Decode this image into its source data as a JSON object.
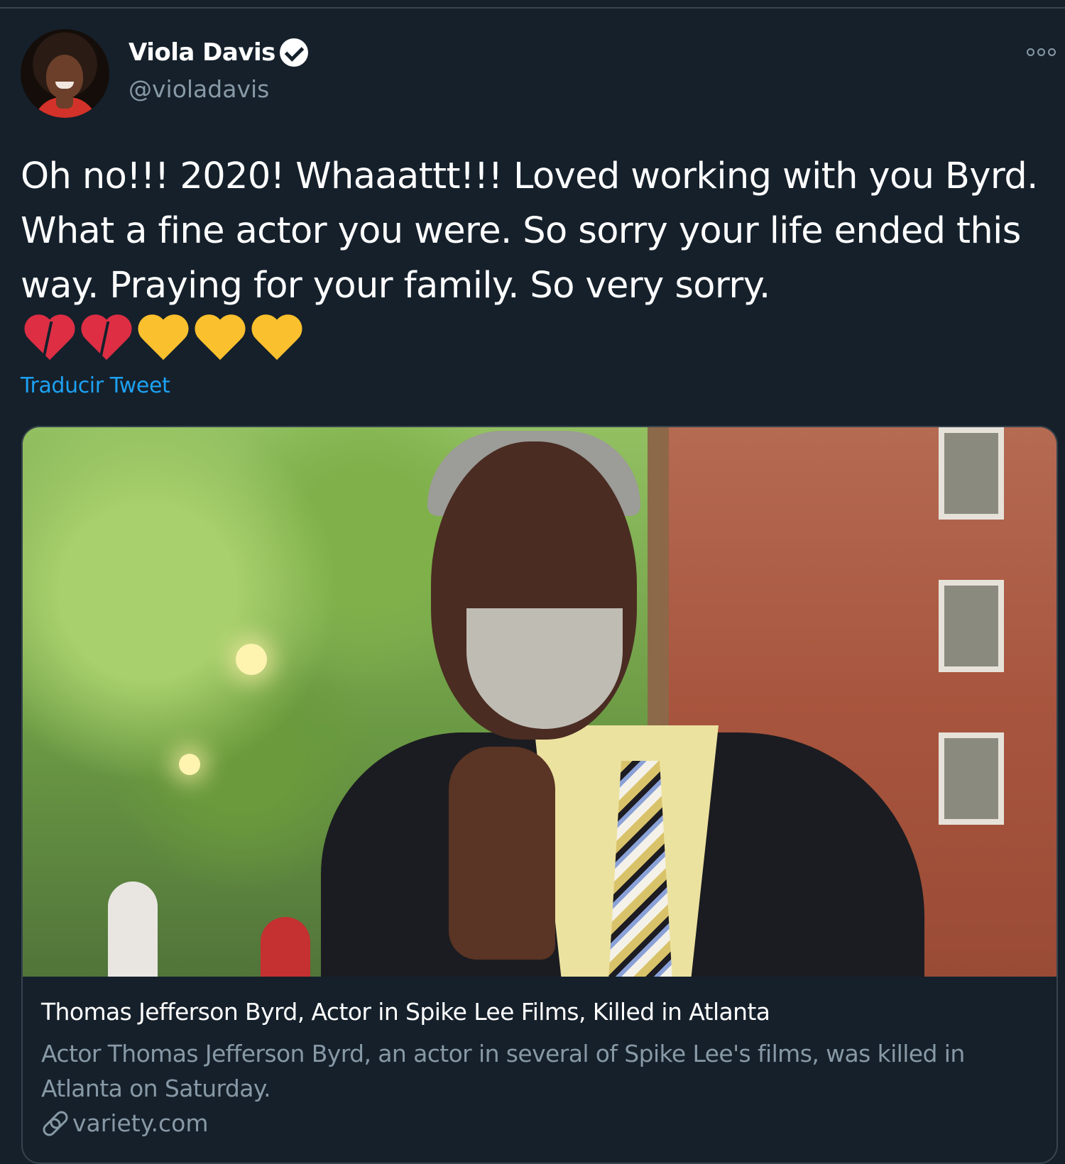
{
  "tweet": {
    "author": {
      "display_name": "Viola Davis",
      "handle": "@violadavis",
      "verified": true
    },
    "text": "Oh no!!! 2020! Whaaattt!!! Loved working with you Byrd. What a fine actor you were. So sorry your life ended this way. Praying for your family. So very sorry.",
    "emojis": [
      "broken-heart",
      "broken-heart",
      "yellow-heart",
      "yellow-heart",
      "yellow-heart"
    ],
    "translate_label": "Traducir Tweet",
    "card": {
      "title": "Thomas Jefferson Byrd, Actor in Spike Lee Films, Killed in Atlanta",
      "description": "Actor Thomas Jefferson Byrd, an actor in several of Spike Lee's films, was killed in Atlanta on Saturday.",
      "domain": "variety.com"
    }
  },
  "colors": {
    "background": "#15202b",
    "link": "#1da1f2",
    "secondary_text": "#8899a6",
    "border": "#38444d"
  }
}
